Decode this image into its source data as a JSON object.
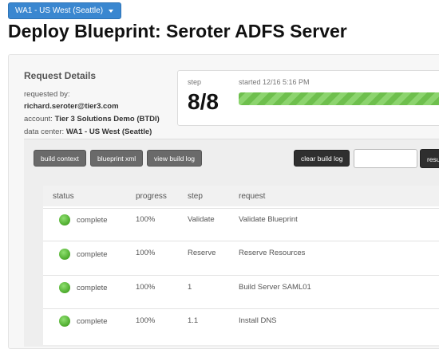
{
  "datacenter_selector": {
    "label": "WA1 - US West (Seattle)"
  },
  "page": {
    "title": "Deploy Blueprint: Seroter ADFS Server"
  },
  "request_details": {
    "title": "Request Details",
    "requested_by_label": "requested by:",
    "requested_by": "richard.seroter@tier3.com",
    "account_label": "account:",
    "account": "Tier 3 Solutions Demo (BTDI)",
    "data_center_label": "data center:",
    "data_center": "WA1 - US West (Seattle)"
  },
  "progress": {
    "step_label": "step",
    "step_value": "8/8",
    "started": "started 12/16 5:16 PM",
    "percent": 100
  },
  "toolbar": {
    "build_context": "build context",
    "blueprint_xml": "blueprint xml",
    "view_build_log": "view build log",
    "clear_build_log": "clear build log",
    "search_value": "",
    "truncated_button": "resu"
  },
  "table": {
    "headers": [
      "status",
      "progress",
      "step",
      "request"
    ],
    "rows": [
      {
        "status": "complete",
        "progress": "100%",
        "step": "Validate",
        "request": "Validate Blueprint"
      },
      {
        "status": "complete",
        "progress": "100%",
        "step": "Reserve",
        "request": "Reserve Resources"
      },
      {
        "status": "complete",
        "progress": "100%",
        "step": "1",
        "request": "Build Server SAML01"
      },
      {
        "status": "complete",
        "progress": "100%",
        "step": "1.1",
        "request": "Install DNS"
      }
    ]
  },
  "colors": {
    "accent": "#3a87d0",
    "status_complete": "#4caa2c",
    "progress_bar": "#6ebf4d"
  }
}
